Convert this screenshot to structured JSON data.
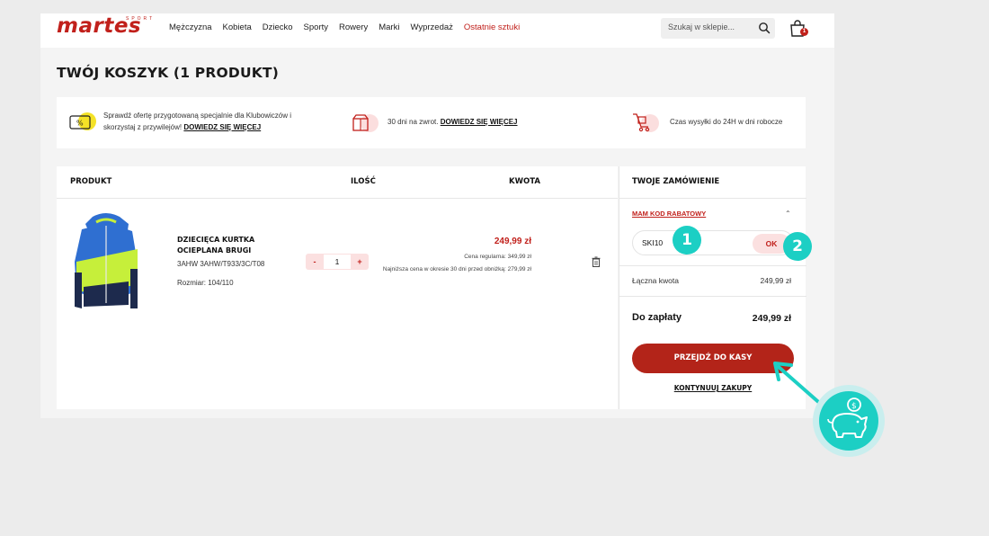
{
  "header": {
    "logo": "martes",
    "logo_sub": "SPORT",
    "nav": [
      "Mężczyzna",
      "Kobieta",
      "Dziecko",
      "Sporty",
      "Rowery",
      "Marki",
      "Wyprzedaż",
      "Ostatnie sztuki"
    ],
    "search_placeholder": "Szukaj w sklepie...",
    "cart_count": "1"
  },
  "page_title": "TWÓJ KOSZYK (1 PRODUKT)",
  "info": {
    "club_text": "Sprawdź ofertę przygotowaną specjalnie dla Klubowiczów i skorzystaj z przywilejów!",
    "club_link": "DOWIEDZ SIĘ WIĘCEJ",
    "return_text": "30 dni na zwrot.",
    "return_link": "DOWIEDZ SIĘ WIĘCEJ",
    "shipping_text": "Czas wysyłki do 24H w dni robocze"
  },
  "table": {
    "col_product": "PRODUKT",
    "col_qty": "ILOŚĆ",
    "col_amount": "KWOTA"
  },
  "product": {
    "name": "DZIECIĘCA KURTKA OCIEPLANA BRUGI",
    "code": "3AHW 3AHW/T933/3C/T08",
    "size": "Rozmiar: 104/110",
    "qty": "1",
    "qty_minus": "-",
    "qty_plus": "+",
    "price": "249,99 zł",
    "regular_price": "Cena regularna: 349,99 zł",
    "lowest_price": "Najniższa cena w okresie 30 dni przed obniżką: 279,99 zł"
  },
  "summary": {
    "title": "TWOJE ZAMÓWIENIE",
    "code_link": "MAM KOD RABATOWY",
    "code_value": "SKI10",
    "ok_label": "OK",
    "total_label": "Łączna kwota",
    "total_value": "249,99 zł",
    "pay_label": "Do zapłaty",
    "pay_value": "249,99 zł",
    "checkout_label": "PRZEJDŹ DO KASY",
    "continue_label": "KONTYNUUJ ZAKUPY"
  },
  "annotations": {
    "step1": "1",
    "step2": "2"
  },
  "colors": {
    "brand": "#c1201b",
    "checkout": "#b32419",
    "annotation": "#1ccfc4"
  }
}
